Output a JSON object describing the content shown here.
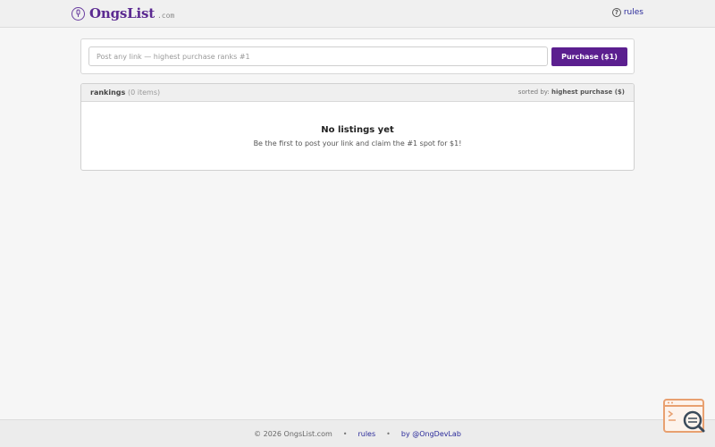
{
  "header": {
    "brand": "OngsList",
    "tld": ".com",
    "rules_label": "rules"
  },
  "post": {
    "placeholder": "Post any link — highest purchase ranks #1",
    "value": "",
    "button_label": "Purchase ($1)"
  },
  "rankings": {
    "title": "rankings",
    "count": "(0 items)",
    "sorted_prefix": "sorted by:",
    "sorted_value": "highest purchase ($)",
    "empty_title": "No listings yet",
    "empty_subtitle": "Be the first to post your link and claim the #1 spot for $1!"
  },
  "footer": {
    "copyright": "© 2026 OngsList.com",
    "separator": "•",
    "rules_label": "rules",
    "author": "by @OngDevLab"
  },
  "colors": {
    "brand": "#5b2a91",
    "button": "#5b1f8f",
    "link": "#2a2a9a",
    "widget_accent": "#e8a070"
  },
  "icons": {
    "logo": "microphone-icon",
    "rules": "help-circle-icon",
    "widget": "search-code-icon"
  }
}
